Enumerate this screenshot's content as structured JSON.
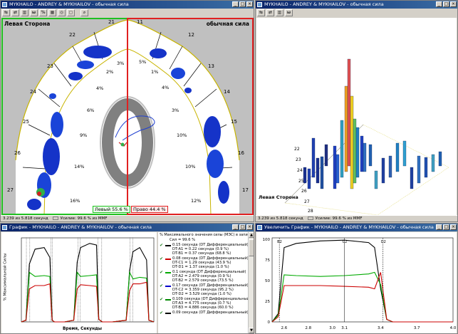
{
  "windows": {
    "top_left": {
      "title": "MYKHAILO - ANDREY & MYKHAILOV - обычная сила",
      "side_left": "Левая Сторона",
      "side_right": "обычная сила",
      "left_pct": "Левый 55.6 %",
      "right_pct": "Право 44.4 %",
      "status_time": "3.239 из 5.818 секунд",
      "status_scale": "Усилие: 99.6 % из MMF",
      "teeth_left": [
        "21",
        "22",
        "23",
        "24",
        "25",
        "26",
        "27"
      ],
      "teeth_right": [
        "11",
        "12",
        "13",
        "14",
        "15",
        "16",
        "17"
      ],
      "pct_left": [
        "3%",
        "2%",
        "4%",
        "6%",
        "9%",
        "14%",
        "16%"
      ],
      "pct_right": [
        "5%",
        "1%",
        "4%",
        "3%",
        "10%",
        "10%",
        "12%"
      ]
    },
    "top_right": {
      "title": "MYKHAILO - ANDREY & MYKHAILOV - обычная сила",
      "side_label": "Левая Сторона",
      "status_time": "3.239 из 5.818 секунд",
      "status_scale": "Усилие: 99.6 % из MMF",
      "axis_teeth": [
        "22",
        "23",
        "24",
        "25",
        "26",
        "27",
        "28"
      ]
    },
    "bottom_left": {
      "title": "График - MYKHAILO - ANDREY & MYKHAILOV - обычная сила",
      "ylabel": "% Максимальной Силы",
      "xlabel": "Время, Секунды",
      "legend_header": "% Максимального значения силы (МЭС) в записи",
      "legend_total": "Сил = 99.6 %",
      "legend": [
        {
          "checked": true,
          "color": "#000000",
          "lines": [
            "0.15 секунда (DT Дифференциальный)",
            "DT-A1 = 0.22 секунда (0.9 %)",
            "DT-B1 = 0.37 секунда (68.8 %)"
          ]
        },
        {
          "checked": true,
          "color": "#cc0000",
          "lines": [
            "0.08 секунда (DT Дифференциальный)",
            "DT-C1 = 1.29 секунда (43.9 %)",
            "DT-D1 = 1.37 секунда (1.0 %)"
          ]
        },
        {
          "checked": true,
          "color": "#00aa00",
          "lines": [
            "0.1 секунда (DT Дифференциальный)",
            "DT-A2 = 2.479 секунда (0.9 %)",
            "DT-B2 = 2.579 секунда (73.5 %)"
          ]
        },
        {
          "checked": true,
          "color": "#0000cc",
          "lines": [
            "0.17 секунда (DT Дифференциальный)",
            "DT-C2 = 3.359 секунда (95.2 %)",
            "DT-D2 = 3.529 секунда (1.0 %)"
          ]
        },
        {
          "checked": true,
          "color": "#008800",
          "lines": [
            "0.109 секунда (DT Дифференциальный)",
            "DT-A3 = 4.775 секунда (0.7 %)",
            "DT-B3 = 4.886 секунда (60.0 %)"
          ]
        },
        {
          "checked": true,
          "color": "#000000",
          "lines": [
            "0.09 секунда (DT Дифференциальный)"
          ]
        }
      ]
    },
    "bottom_right": {
      "title": "Увеличить График - MYKHAILO - ANDREY & MYKHAILOV - обычная сила",
      "yticks": [
        "100",
        "75",
        "50",
        "25",
        "0"
      ],
      "xticks": [
        "2.6",
        "2.8",
        "3.0",
        "3.1",
        "3.4",
        "3.7",
        "4.0"
      ],
      "marker_labels": [
        "B2",
        "C2",
        "D2"
      ]
    }
  },
  "chart_data": [
    {
      "type": "line",
      "title": "",
      "xlabel": "Время, Секунды",
      "ylabel": "% Максимальной Силы",
      "ylim": [
        0,
        100
      ],
      "xlim": [
        0,
        5.818
      ],
      "series": [
        {
          "color": "#000000",
          "x": [
            0.0,
            0.2,
            0.35,
            0.6,
            1.0,
            1.25,
            1.35,
            1.45,
            1.9,
            2.3,
            2.45,
            2.6,
            3.0,
            3.3,
            3.4,
            3.55,
            4.0,
            4.6,
            4.75,
            4.9,
            5.2,
            5.5,
            5.6,
            5.818
          ],
          "y": [
            0,
            2,
            70,
            88,
            90,
            78,
            2,
            0,
            0,
            2,
            72,
            90,
            95,
            93,
            3,
            0,
            0,
            2,
            62,
            85,
            90,
            75,
            2,
            0
          ]
        },
        {
          "color": "#00aa00",
          "x": [
            0.0,
            0.2,
            0.35,
            0.6,
            1.0,
            1.25,
            1.35,
            1.45,
            1.9,
            2.3,
            2.45,
            2.6,
            3.0,
            3.3,
            3.4,
            3.55,
            4.0,
            4.6,
            4.75,
            4.9,
            5.2,
            5.5,
            5.6,
            5.818
          ],
          "y": [
            0,
            2,
            60,
            55,
            56,
            55,
            2,
            0,
            0,
            2,
            60,
            55,
            56,
            57,
            3,
            0,
            0,
            2,
            60,
            52,
            54,
            53,
            2,
            0
          ]
        },
        {
          "color": "#cc0000",
          "x": [
            0.0,
            0.2,
            0.35,
            0.6,
            1.0,
            1.25,
            1.35,
            1.45,
            1.9,
            2.3,
            2.45,
            2.6,
            3.0,
            3.3,
            3.4,
            3.55,
            4.0,
            4.6,
            4.75,
            4.9,
            5.2,
            5.5,
            5.6,
            5.818
          ],
          "y": [
            0,
            2,
            40,
            44,
            44,
            46,
            2,
            0,
            0,
            2,
            40,
            45,
            44,
            43,
            3,
            0,
            0,
            2,
            38,
            46,
            46,
            48,
            2,
            0
          ]
        }
      ]
    },
    {
      "type": "line",
      "title": "",
      "xlabel": "",
      "ylabel": "",
      "ylim": [
        0,
        100
      ],
      "xlim": [
        2.5,
        4.0
      ],
      "series": [
        {
          "color": "#000000",
          "x": [
            2.5,
            2.55,
            2.6,
            2.7,
            2.9,
            3.1,
            3.3,
            3.35,
            3.4,
            3.45,
            3.5,
            4.0
          ],
          "y": [
            0,
            10,
            90,
            95,
            98,
            99,
            96,
            90,
            40,
            3,
            0,
            0
          ]
        },
        {
          "color": "#00aa00",
          "x": [
            2.5,
            2.55,
            2.6,
            2.7,
            2.9,
            3.1,
            3.3,
            3.35,
            3.4,
            3.45,
            3.5,
            4.0
          ],
          "y": [
            0,
            8,
            57,
            56,
            55,
            56,
            58,
            60,
            45,
            3,
            0,
            0
          ]
        },
        {
          "color": "#cc0000",
          "x": [
            2.5,
            2.55,
            2.6,
            2.7,
            2.9,
            3.1,
            3.3,
            3.35,
            3.4,
            3.45,
            3.5,
            4.0
          ],
          "y": [
            0,
            6,
            44,
            44,
            44,
            43,
            42,
            40,
            60,
            3,
            0,
            0
          ]
        }
      ]
    }
  ]
}
